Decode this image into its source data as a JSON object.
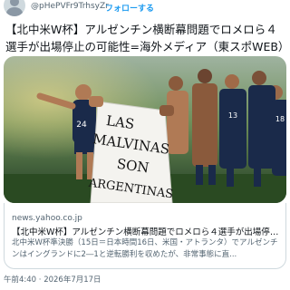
{
  "tweet": {
    "handle": "@pHePVFr9TrhsyZr",
    "separator": "·",
    "follow_label": "フォローする",
    "text": "【北中米W杯】アルゼンチン横断幕問題でロメロら４選手が出場停止の可能性=海外メディア（東スポWEB）",
    "timestamp": "午前4:40 · 2026年7月17日"
  },
  "photo": {
    "banner_lines": [
      "LAS",
      "MALVINAS",
      "SON",
      "ARGENTINAS"
    ],
    "jersey_numbers": [
      "24",
      "13",
      "18"
    ]
  },
  "card": {
    "domain": "news.yahoo.co.jp",
    "title": "【北中米W杯】アルゼンチン横断幕問題でロメロら４選手が出場停止...",
    "description": "北中米W杯準決勝（15日＝日本時間16日、米国・アトランタ）でアルゼンチンはイングランドに2―1と逆転勝利を収めたが、非常事態に直..."
  },
  "colors": {
    "accent": "#1d9bf0",
    "jersey": "#1a2a4a"
  },
  "icons": [
    "avatar-icon"
  ]
}
